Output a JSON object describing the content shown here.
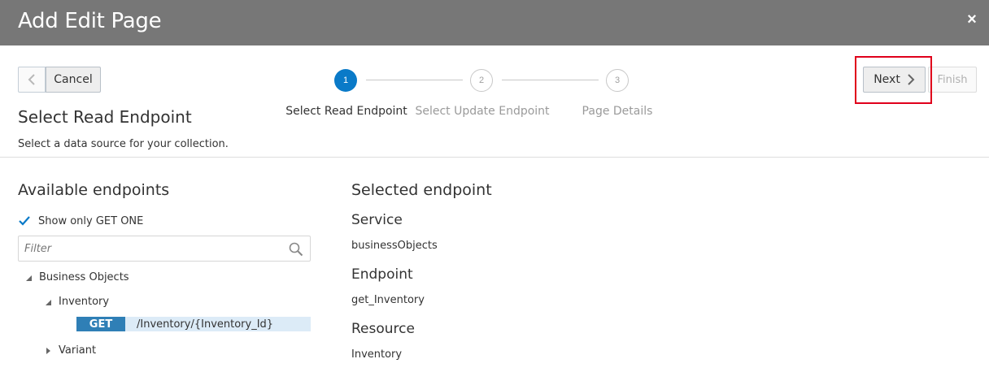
{
  "dialog": {
    "title": "Add Edit Page",
    "close_symbol": "×"
  },
  "toolbar": {
    "back_icon": "chevron-left-icon",
    "cancel_label": "Cancel",
    "next_label": "Next",
    "next_icon": "chevron-right-icon",
    "finish_label": "Finish"
  },
  "train": {
    "steps": [
      {
        "number": "1",
        "label": "Select Read Endpoint",
        "state": "active"
      },
      {
        "number": "2",
        "label": "Select Update Endpoint",
        "state": "inactive"
      },
      {
        "number": "3",
        "label": "Page Details",
        "state": "inactive"
      }
    ]
  },
  "page": {
    "heading": "Select Read Endpoint",
    "description": "Select a data source for your collection."
  },
  "available": {
    "title": "Available endpoints",
    "checkbox_label": "Show only GET ONE",
    "checkbox_checked": true,
    "filter_placeholder": "Filter",
    "tree": {
      "root": "Business Objects",
      "child1": "Inventory",
      "endpoint_method": "GET",
      "endpoint_path": "/Inventory/{Inventory_Id}",
      "child2": "Variant"
    }
  },
  "selected": {
    "title": "Selected endpoint",
    "service_label": "Service",
    "service_value": "businessObjects",
    "endpoint_label": "Endpoint",
    "endpoint_value": "get_Inventory",
    "resource_label": "Resource",
    "resource_value": "Inventory"
  },
  "colors": {
    "titlebar": "#777777",
    "accent": "#0a7ac8",
    "highlight": "#e0001b",
    "method_bg": "#2f7fb6",
    "selected_row": "#dcebf7"
  }
}
